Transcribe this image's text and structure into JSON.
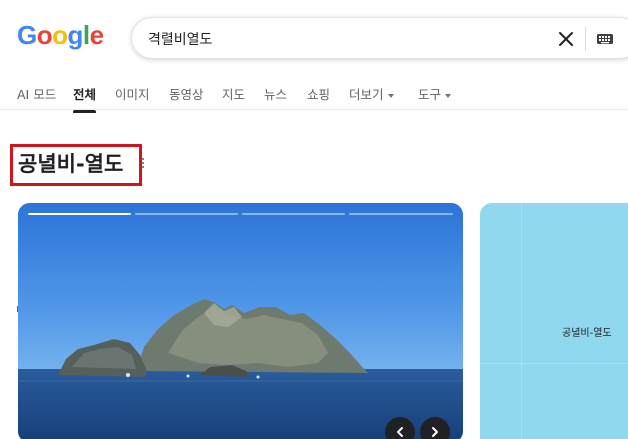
{
  "logo": {
    "letters": [
      "G",
      "o",
      "o",
      "g",
      "l",
      "e"
    ],
    "colors": [
      "#4285F4",
      "#EA4335",
      "#FBBC05",
      "#4285F4",
      "#34A853",
      "#EA4335"
    ]
  },
  "search": {
    "query": "격렬비열도",
    "clear_icon": "close-icon",
    "keyboard_icon": "keyboard-icon"
  },
  "tabs": [
    {
      "label": "AI 모드"
    },
    {
      "label": "전체",
      "active": true
    },
    {
      "label": "이미지"
    },
    {
      "label": "동영상"
    },
    {
      "label": "지도"
    },
    {
      "label": "뉴스"
    },
    {
      "label": "쇼핑"
    },
    {
      "label": "더보기",
      "dropdown": true
    },
    {
      "label": "도구",
      "dropdown": true
    }
  ],
  "entity": {
    "title": "공녈비-열도",
    "more_icon": "more-vert-icon",
    "highlight_color": "#d0151c"
  },
  "image_carousel": {
    "segments": 4,
    "current_segment": 1
  },
  "map": {
    "label": "공녈비-열도"
  }
}
